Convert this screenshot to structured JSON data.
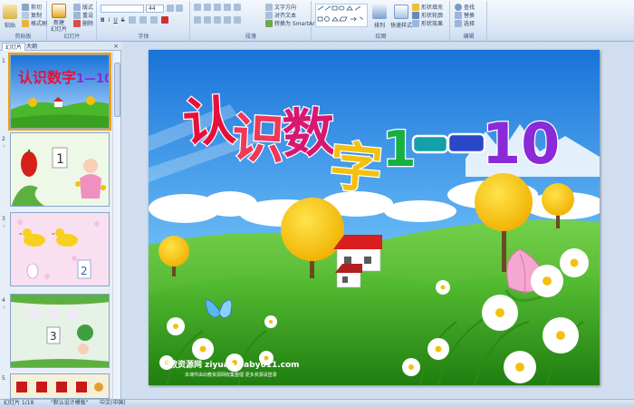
{
  "ribbon": {
    "clipboard": {
      "paste": "粘贴",
      "cut": "剪切",
      "copy": "复制",
      "format_painter": "格式刷",
      "label": "剪贴板"
    },
    "slides": {
      "new_slide": "新建\n幻灯片",
      "layout": "版式",
      "reset": "重设",
      "delete": "删除",
      "label": "幻灯片"
    },
    "font": {
      "font_name": "",
      "font_size": "44",
      "label": "字体"
    },
    "paragraph": {
      "text_direction": "文字方向",
      "align_text": "对齐文本",
      "smartart": "转换为 SmartArt",
      "label": "段落"
    },
    "drawing": {
      "arrange": "排列",
      "quick_styles": "快速样式",
      "shape_fill": "形状填充",
      "shape_outline": "形状轮廓",
      "shape_effects": "形状效果",
      "label": "绘图"
    },
    "editing": {
      "find": "查找",
      "replace": "替换",
      "select": "选择",
      "label": "编辑"
    }
  },
  "panel": {
    "tab_slides": "幻灯片",
    "tab_outline": "大纲",
    "close": "×",
    "slides": [
      {
        "num": "1",
        "title": "认识数字1——10"
      },
      {
        "num": "2"
      },
      {
        "num": "3"
      },
      {
        "num": "4"
      },
      {
        "num": "5"
      }
    ]
  },
  "slide": {
    "title_chars": [
      "认",
      "识",
      "数",
      "字",
      "1",
      "10"
    ],
    "watermark": "幼教资源网 ziyuan.baby611.com",
    "watermark_sub": "本课件由幼教资源网收集整理 更多资源请登录"
  },
  "status": {
    "slide_count": "幻灯片 1/18",
    "theme": "\"默认设计模板\"",
    "language": "中文(中国)"
  },
  "colors": {
    "sky_top": "#1a73d8",
    "sky_bottom": "#a8dcff",
    "grass": "#4ab82c",
    "title_red": "#e8103a",
    "title_purple": "#8a2ad8",
    "title_green": "#18b040",
    "title_yellow": "#f4c010"
  }
}
